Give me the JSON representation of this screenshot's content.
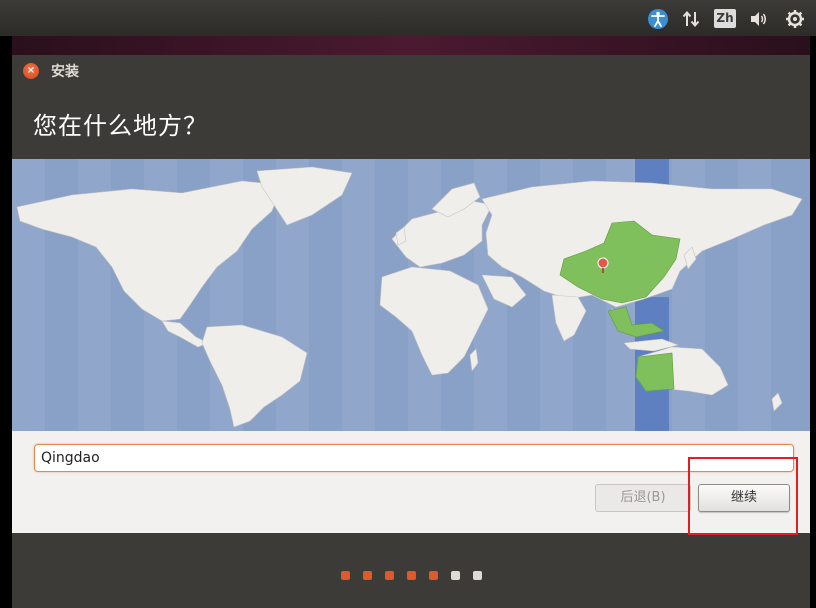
{
  "window": {
    "title": "安装",
    "close_glyph": "×"
  },
  "page": {
    "heading": "您在什么地方？"
  },
  "panel": {
    "keyboard_layout": "Zh"
  },
  "location": {
    "value": "Qingdao"
  },
  "buttons": {
    "back_label": "后退(B)",
    "continue_label": "继续"
  },
  "progress": {
    "total_steps": 7,
    "completed_steps": 5,
    "done_color": "#e05a27",
    "pending_color": "#dfdbd2"
  },
  "map": {
    "ocean_color": "#8aa1c7",
    "land_color": "#f0eeea",
    "selected_zone_color": "#7fc05c",
    "highlight_band_color": "#5e80c0"
  },
  "icons": [
    "accessibility-icon",
    "network-icon",
    "volume-icon",
    "settings-icon",
    "location-pin-icon"
  ]
}
